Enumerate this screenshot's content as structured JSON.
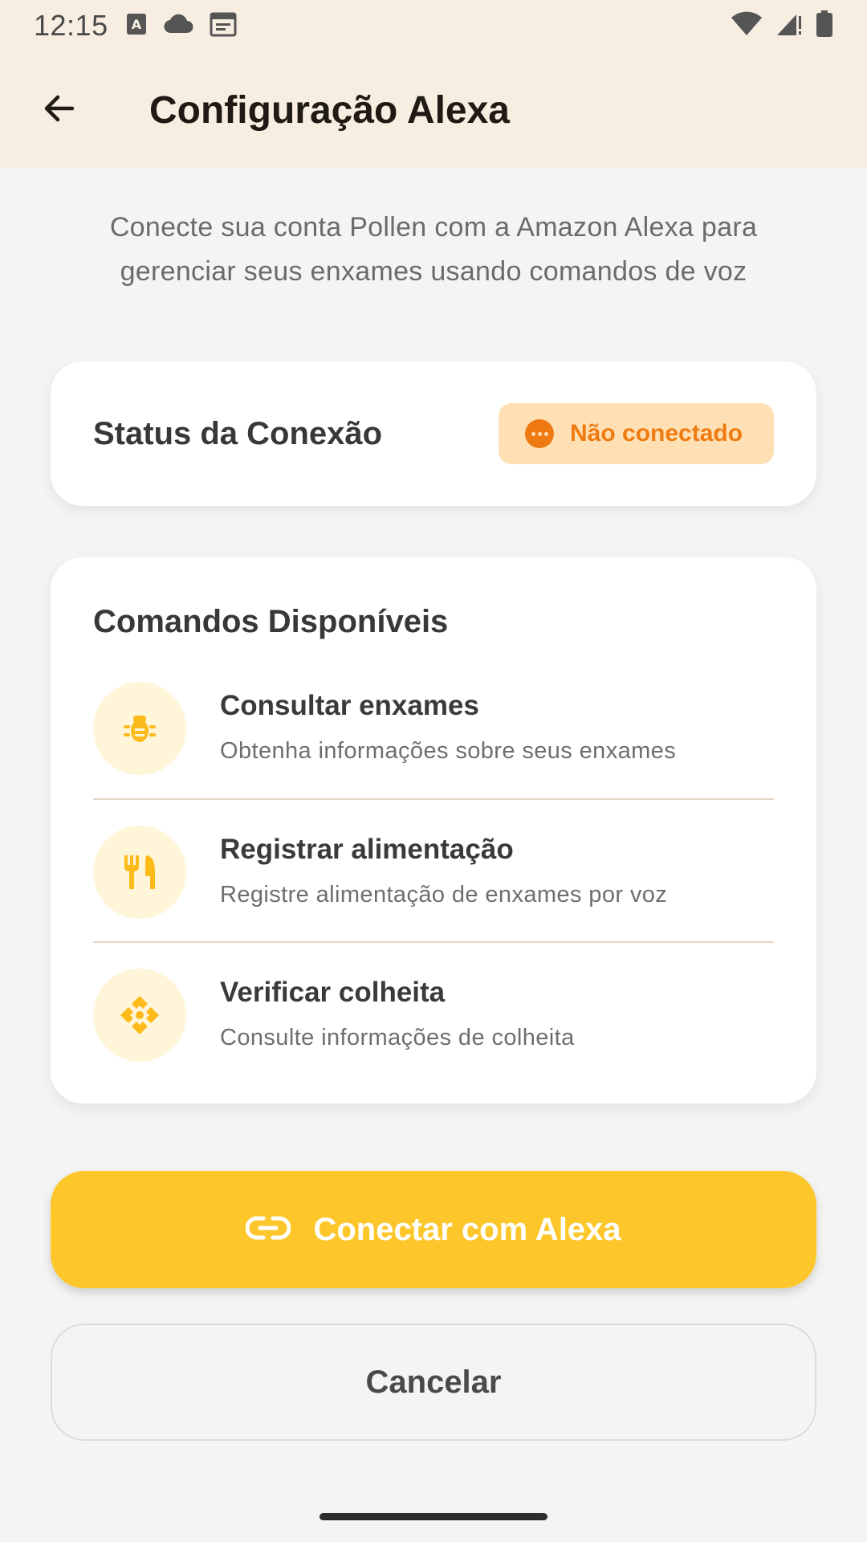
{
  "status_bar": {
    "time": "12:15",
    "left_icons": [
      "font-a-icon",
      "cloud-icon",
      "calendar-icon"
    ],
    "right_icons": [
      "wifi-icon",
      "cellular-signal-icon",
      "battery-icon"
    ]
  },
  "app_bar": {
    "back_icon": "arrow-back-icon",
    "title": "Configuração Alexa",
    "background": "#f7eee1"
  },
  "intro_text": "Conecte sua conta Pollen com a Amazon Alexa para gerenciar seus enxames usando comandos de voz",
  "connection_status": {
    "label": "Status da Conexão",
    "badge": {
      "text": "Não conectado",
      "icon": "more-horizontal-circle-icon",
      "color": "#ef7b10",
      "background": "#ffe0b5"
    }
  },
  "commands": {
    "title": "Comandos Disponíveis",
    "items": [
      {
        "icon": "bug-icon",
        "title": "Consultar enxames",
        "description": "Obtenha informações sobre seus enxames"
      },
      {
        "icon": "fork-knife-icon",
        "title": "Registrar alimentação",
        "description": "Registre alimentação de enxames por voz"
      },
      {
        "icon": "harvest-icon",
        "title": "Verificar colheita",
        "description": "Consulte informações de colheita"
      }
    ],
    "icon_color": "#fcbb1a",
    "icon_background": "#fff5d9"
  },
  "buttons": {
    "connect": {
      "label": "Conectar com Alexa",
      "icon": "link-icon",
      "background": "#fdc72b"
    },
    "cancel": {
      "label": "Cancelar"
    }
  }
}
